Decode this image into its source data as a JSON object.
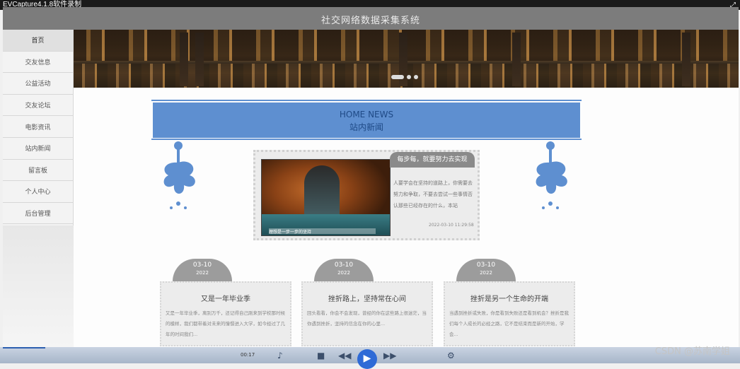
{
  "recorder": {
    "title": "EVCapture4.1.8软件录制",
    "corner_icon": "expand-icon"
  },
  "header": {
    "title": "社交网络数据采集系统"
  },
  "sidebar": {
    "items": [
      {
        "label": "首页",
        "active": true
      },
      {
        "label": "交友信息"
      },
      {
        "label": "公益活动"
      },
      {
        "label": "交友论坛"
      },
      {
        "label": "电影资讯"
      },
      {
        "label": "站内新闻"
      },
      {
        "label": "留言板"
      },
      {
        "label": "个人中心"
      },
      {
        "label": "后台管理"
      }
    ]
  },
  "news_header": {
    "en": "HOME NEWS",
    "zh": "站内新闻"
  },
  "featured": {
    "tag": "每步每，就要努力去实现",
    "excerpt": "人要学会在坚持的道路上，你需要去努力和争取，不要去尝试一些事情否认那些已经存在的什么，本站",
    "date": "2022-03-10 11:29:58",
    "image_caption": "理想是一步一步的坚持"
  },
  "cards": [
    {
      "date": "03-10",
      "year": "2022",
      "title": "又是一年毕业季",
      "text": "又是一年毕业季，离别万千，还记得自己刚来到学校那时候的模样，我们都带着对未来的憧憬进入大学，如今经过了几年的时间我们..."
    },
    {
      "date": "03-10",
      "year": "2022",
      "title": "挫折路上，坚持常在心间",
      "text": "回头看看，你会不会发现，曾经的你在这些路上很迷茫，当你遇到挫折，坚持的信念在你的心里..."
    },
    {
      "date": "03-10",
      "year": "2022",
      "title": "挫折是另一个生命的开端",
      "text": "当遇到挫折或失败，你是看到失败还是看到机会？挫折是我们每个人成长的必经之路，它不是结束而是新的开始，学会..."
    }
  ],
  "player": {
    "time": "00:17"
  },
  "watermark": "CSDN @苏南学姐"
}
